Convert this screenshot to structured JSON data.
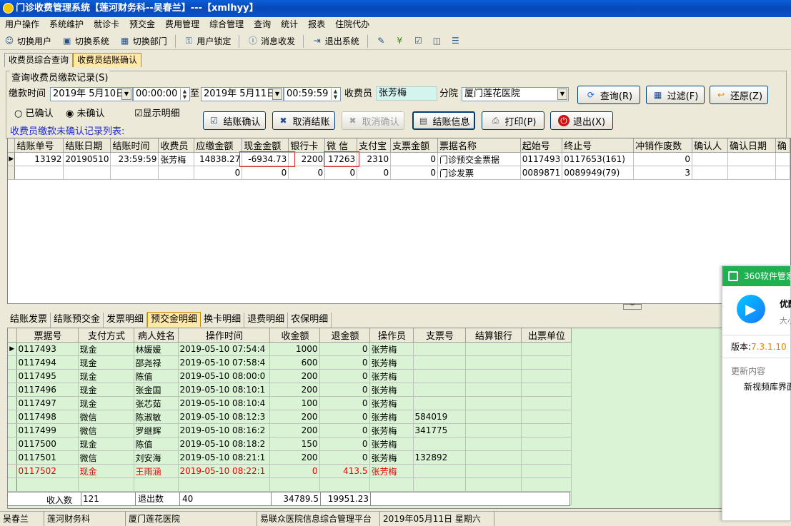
{
  "window": {
    "title": "门诊收费管理系统【莲河财务科--吴春兰】---【xmlhyy】"
  },
  "menu": [
    "用户操作",
    "系统维护",
    "就诊卡",
    "预交金",
    "费用管理",
    "综合管理",
    "查询",
    "统计",
    "报表",
    "住院代办"
  ],
  "toolbar": {
    "switch_user": "切换用户",
    "switch_system": "切换系统",
    "switch_dept": "切换部门",
    "lock_user": "用户锁定",
    "messages": "消息收发",
    "exit_system": "退出系统"
  },
  "tabs": [
    "收费员综合查询",
    "收费员结账确认"
  ],
  "query": {
    "group_title": "查询收费员缴款记录(S)",
    "pay_time_label": "缴款时间",
    "date_from": "2019年 5月10日",
    "time_from": "00:00:00",
    "to_label": "至",
    "date_to": "2019年 5月11日",
    "time_to": "00:59:59",
    "cashier_label": "收费员",
    "cashier_value": "张芳梅",
    "branch_label": "分院",
    "branch_value": "厦门莲花医院",
    "btn_query": "查询(R)",
    "btn_filter": "过滤(F)",
    "btn_restore": "还原(Z)",
    "radio_confirmed": "已确认",
    "radio_unconfirmed": "未确认",
    "chk_detail": "显示明细",
    "btn_confirm": "结账确认",
    "btn_cancel": "取消结账",
    "btn_cancel_confirm": "取消确认",
    "btn_info": "结账信息",
    "btn_print": "打印(P)",
    "btn_exit": "退出(X)",
    "list_label": "收费员缴款未确认记录列表:"
  },
  "grid1": {
    "headers": [
      "结账单号",
      "结账日期",
      "结账时间",
      "收费员",
      "应缴金额",
      "现金金额",
      "银行卡",
      "微 信",
      "支付宝",
      "支票金额",
      "票据名称",
      "起始号",
      "终止号",
      "冲销作废数",
      "确认人",
      "确认日期",
      "确"
    ],
    "rows": [
      [
        "13192",
        "20190510",
        "23:59:59",
        "张芳梅",
        "14838.27",
        "-6934.73",
        "2200",
        "17263",
        "2310",
        "0",
        "门诊预交金票据",
        "0117493",
        "0117653(161)",
        "0",
        "",
        "",
        ""
      ],
      [
        "",
        "",
        "",
        "",
        "0",
        "0",
        "0",
        "0",
        "0",
        "0",
        "门诊发票",
        "0089871",
        "0089949(79)",
        "3",
        "",
        "",
        ""
      ]
    ]
  },
  "tabs2": [
    "结账发票",
    "结账预交金",
    "发票明细",
    "预交金明细",
    "换卡明细",
    "退费明细",
    "农保明细"
  ],
  "grid2": {
    "headers": [
      "票据号",
      "支付方式",
      "病人姓名",
      "操作时间",
      "收金额",
      "退金额",
      "操作员",
      "支票号",
      "结算银行",
      "出票单位"
    ],
    "rows": [
      [
        "0117493",
        "现金",
        "林媛媛",
        "2019-05-10 07:54:4",
        "1000",
        "0",
        "张芳梅",
        "",
        "",
        ""
      ],
      [
        "0117494",
        "现金",
        "邵尧禄",
        "2019-05-10 07:58:4",
        "600",
        "0",
        "张芳梅",
        "",
        "",
        ""
      ],
      [
        "0117495",
        "现金",
        "陈值",
        "2019-05-10 08:00:0",
        "200",
        "0",
        "张芳梅",
        "",
        "",
        ""
      ],
      [
        "0117496",
        "现金",
        "张金国",
        "2019-05-10 08:10:1",
        "200",
        "0",
        "张芳梅",
        "",
        "",
        ""
      ],
      [
        "0117497",
        "现金",
        "张芯茹",
        "2019-05-10 08:10:4",
        "100",
        "0",
        "张芳梅",
        "",
        "",
        ""
      ],
      [
        "0117498",
        "微信",
        "陈淑敏",
        "2019-05-10 08:12:3",
        "200",
        "0",
        "张芳梅",
        "584019",
        "",
        ""
      ],
      [
        "0117499",
        "微信",
        "罗继辉",
        "2019-05-10 08:16:2",
        "200",
        "0",
        "张芳梅",
        "341775",
        "",
        ""
      ],
      [
        "0117500",
        "现金",
        "陈值",
        "2019-05-10 08:18:2",
        "150",
        "0",
        "张芳梅",
        "",
        "",
        ""
      ],
      [
        "0117501",
        "微信",
        "刘安海",
        "2019-05-10 08:21:1",
        "200",
        "0",
        "张芳梅",
        "132892",
        "",
        ""
      ],
      [
        "0117502",
        "现金",
        "王雨涵",
        "2019-05-10 08:22:1",
        "0",
        "413.5",
        "张芳梅",
        "",
        "",
        ""
      ]
    ],
    "footer": {
      "in_label": "收入数",
      "in_count": "121",
      "out_label": "退出数",
      "out_count": "40",
      "total_in": "34789.5",
      "total_out": "19951.23"
    }
  },
  "status": [
    "吴春兰",
    "莲河财务科",
    "厦门莲花医院",
    "易联众医院信息综合管理平台",
    "2019年05月11日 星期六"
  ],
  "popup": {
    "title": "360软件管家",
    "app_name": "优酷",
    "app_sub": "大小",
    "version_label": "版本:",
    "version": "7.3.1.10",
    "update_label": "更新内容",
    "update_text": "新视频库界面"
  },
  "colors": {
    "grid_green": "#d9f3d4",
    "active_tab": "#ffe8a8",
    "title_blue": "#0a5fd8",
    "highlight_red": "#e03030"
  }
}
